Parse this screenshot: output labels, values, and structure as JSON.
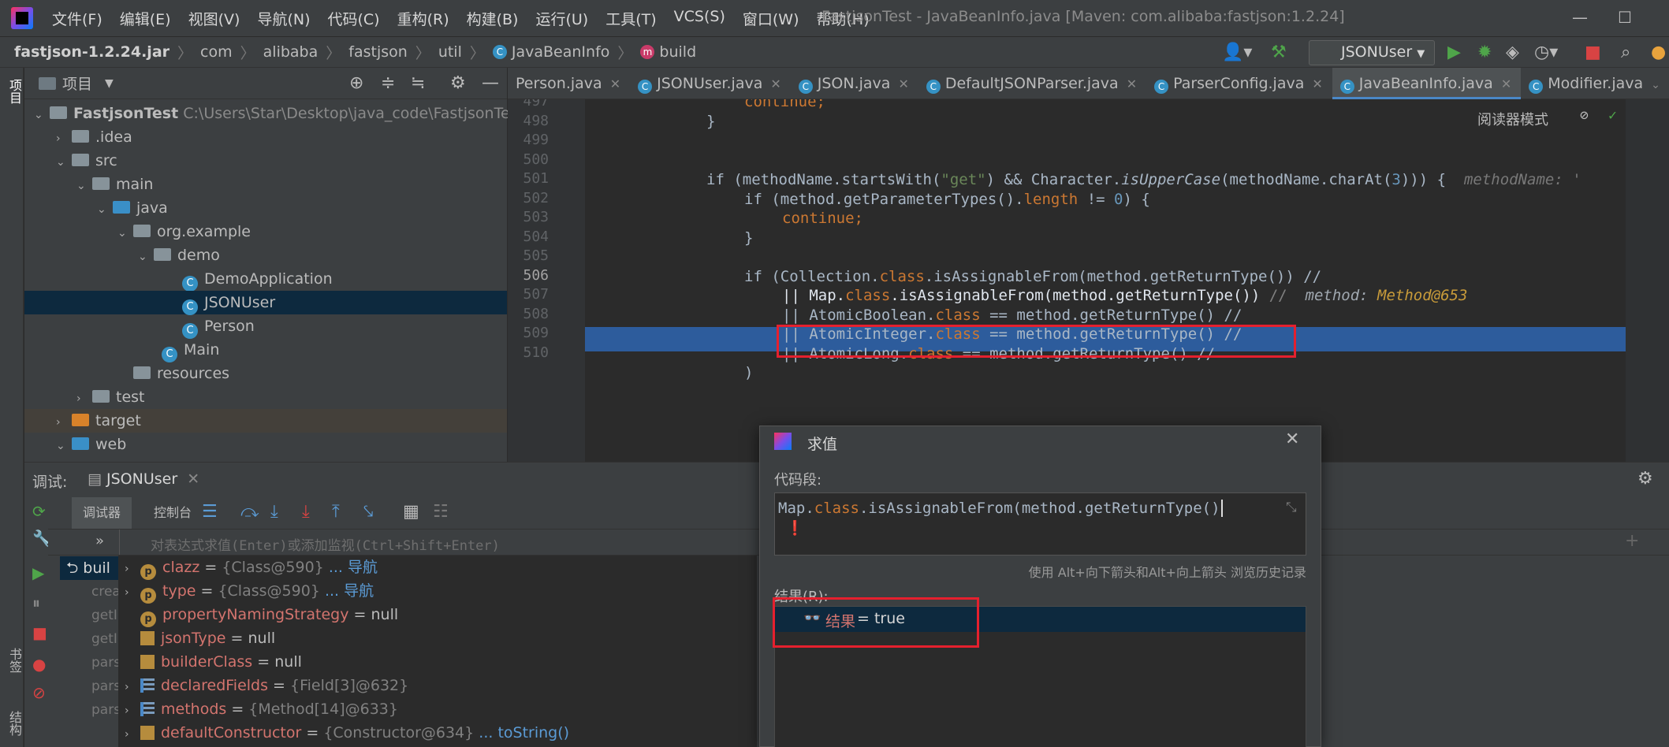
{
  "menu": [
    "文件(F)",
    "编辑(E)",
    "视图(V)",
    "导航(N)",
    "代码(C)",
    "重构(R)",
    "构建(B)",
    "运行(U)",
    "工具(T)",
    "VCS(S)",
    "窗口(W)",
    "帮助(H)"
  ],
  "window_title": "FastjsonTest - JavaBeanInfo.java [Maven: com.alibaba:fastjson:1.2.24]",
  "breadcrumb": [
    "fastjson-1.2.24.jar",
    "com",
    "alibaba",
    "fastjson",
    "util",
    "JavaBeanInfo",
    "build"
  ],
  "run_config": "JSONUser",
  "left_strip": {
    "project": "项目",
    "bookmarks": "书签",
    "structure": "结构"
  },
  "project_panel": {
    "title": "项目",
    "tree": [
      {
        "label": "FastjsonTest",
        "path": "C:\\Users\\Star\\Desktop\\java_code\\FastjsonTest"
      },
      {
        "label": ".idea"
      },
      {
        "label": "src"
      },
      {
        "label": "main"
      },
      {
        "label": "java"
      },
      {
        "label": "org.example"
      },
      {
        "label": "demo"
      },
      {
        "label": "DemoApplication"
      },
      {
        "label": "JSONUser"
      },
      {
        "label": "Person"
      },
      {
        "label": "Main"
      },
      {
        "label": "resources"
      },
      {
        "label": "test"
      },
      {
        "label": "target"
      },
      {
        "label": "web"
      }
    ]
  },
  "editor_tabs": [
    "Person.java",
    "JSONUser.java",
    "JSON.java",
    "DefaultJSONParser.java",
    "ParserConfig.java",
    "JavaBeanInfo.java",
    "Modifier.java"
  ],
  "reader_mode": "阅读器模式",
  "line_numbers": [
    "497",
    "498",
    "499",
    "500",
    "501",
    "502",
    "503",
    "504",
    "505",
    "506",
    "507",
    "508",
    "509",
    "510"
  ],
  "code": {
    "l497": "continue;",
    "l498": "}",
    "l500_a": "if (methodName.startsWith(",
    "l500_s": "\"get\"",
    "l500_b": ") && Character.",
    "l500_c": "isUpperCase",
    "l500_d": "(methodName.charAt(",
    "l500_n": "3",
    "l500_e": "))) {",
    "l500_hint": "methodName: '",
    "l501_a": "if (method.getParameterTypes().",
    "l501_k": "length",
    "l501_b": " != ",
    "l501_n": "0",
    "l501_c": ") {",
    "l502": "continue;",
    "l503": "}",
    "l505_a": "if (Collection.",
    "l505_k": "class",
    "l505_b": ".isAssignableFrom(method.getReturnType()) //",
    "l506_a": "|| Map.",
    "l506_k": "class",
    "l506_b": ".isAssignableFrom(method.getReturnType())",
    "l506_c": " //",
    "l506_hint": "method: ",
    "l506_hint_val": "Method@653",
    "l507_a": "|| AtomicBoolean.",
    "l507_k": "class",
    "l507_b": " == method.getReturnType() //",
    "l508_a": "|| AtomicInteger.",
    "l508_k": "class",
    "l508_b": " == method.getReturnType() //",
    "l509_a": "|| AtomicLong.",
    "l509_k": "class",
    "l509_b": " == method.getReturnType() //",
    "l510": ")"
  },
  "debug": {
    "label": "调试:",
    "session": "JSONUser",
    "tab_debugger": "调试器",
    "tab_console": "控制台",
    "eval_placeholder": "对表达式求值(Enter)或添加监视(Ctrl+Shift+Enter)",
    "frames": [
      "buil",
      "crea",
      "getI",
      "getI",
      "pars",
      "pars",
      "pars"
    ],
    "variables": [
      {
        "name": "clazz",
        "value": "{Class@590}",
        "link": "... 导航",
        "kind": "p"
      },
      {
        "name": "type",
        "value": "{Class@590}",
        "link": "... 导航",
        "kind": "p"
      },
      {
        "name": "propertyNamingStrategy",
        "value": "null",
        "link": "",
        "kind": "p"
      },
      {
        "name": "jsonType",
        "value": "null",
        "link": "",
        "kind": "f"
      },
      {
        "name": "builderClass",
        "value": "null",
        "link": "",
        "kind": "f"
      },
      {
        "name": "declaredFields",
        "value": "{Field[3]@632}",
        "link": "",
        "kind": "l"
      },
      {
        "name": "methods",
        "value": "{Method[14]@633}",
        "link": "",
        "kind": "l"
      },
      {
        "name": "defaultConstructor",
        "value": "{Constructor@634}",
        "link": "... toString()",
        "kind": "f"
      }
    ]
  },
  "eval_dialog": {
    "title": "求值",
    "snippet_label": "代码段:",
    "expr_a": "Map.",
    "expr_k": "class",
    "expr_b": ".isAssignableFrom(method.getReturnType()",
    "history_hint": "使用 Alt+向下箭头和Alt+向上箭头 浏览历史记录",
    "result_label": "结果(R):",
    "result_name": "结果",
    "result_value": "= true"
  },
  "colors": {
    "highlight": "#2d5c9c",
    "redbox": "#e5202e",
    "keyword": "#cc7832"
  }
}
